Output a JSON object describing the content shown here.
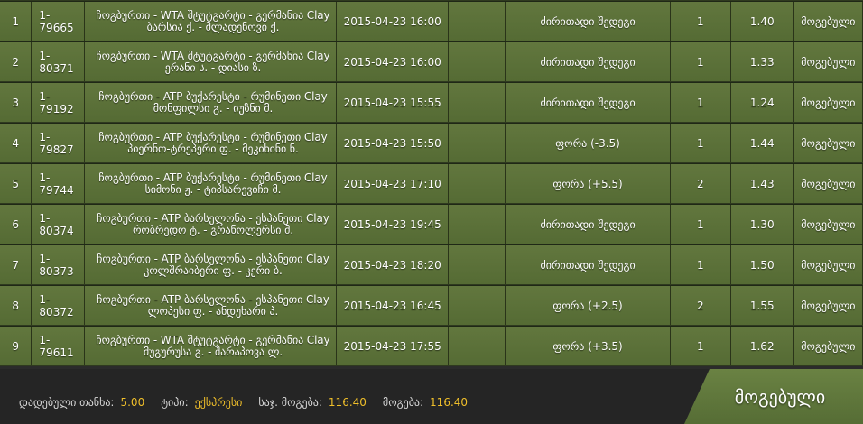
{
  "rows": [
    {
      "num": "1",
      "id": "1-79665",
      "event_line1": "ჩოგბურთი - WTA შტუტგარტი - გერმანია Clay",
      "event_line2": "ბარსია ქ. - მლადენოვი ქ.",
      "date": "2015-04-23 16:00",
      "type": "ძირითადი შედეგი",
      "count": "1",
      "odds": "1.40",
      "status": "მოგებული"
    },
    {
      "num": "2",
      "id": "1-80371",
      "event_line1": "ჩოგბურთი - WTA შტუტგარტი - გერმანია Clay",
      "event_line2": "ერანი ს. - დიასი ზ.",
      "date": "2015-04-23 16:00",
      "type": "ძირითადი შედეგი",
      "count": "1",
      "odds": "1.33",
      "status": "მოგებული"
    },
    {
      "num": "3",
      "id": "1-79192",
      "event_line1": "ჩოგბურთი - ATP ბუქარესტი - რუმინეთი Clay",
      "event_line2": "მონფილსი გ. - იუზნი მ.",
      "date": "2015-04-23 15:55",
      "type": "ძირითადი შედეგი",
      "count": "1",
      "odds": "1.24",
      "status": "მოგებული"
    },
    {
      "num": "4",
      "id": "1-79827",
      "event_line1": "ჩოგბურთი - ATP ბუქარესტი - რუმინეთი Clay",
      "event_line2": "პიერნო-ტრეპერი ფ. - მეკიხინი ნ.",
      "date": "2015-04-23 15:50",
      "type": "ფორა (-3.5)",
      "count": "1",
      "odds": "1.44",
      "status": "მოგებული"
    },
    {
      "num": "5",
      "id": "1-79744",
      "event_line1": "ჩოგბურთი - ATP ბუქარესტი - რუმინეთი Clay",
      "event_line2": "სიმონი ჟ. - ტიპსარევიჩი მ.",
      "date": "2015-04-23 17:10",
      "type": "ფორა (+5.5)",
      "count": "2",
      "odds": "1.43",
      "status": "მოგებული"
    },
    {
      "num": "6",
      "id": "1-80374",
      "event_line1": "ჩოგბურთი - ATP ბარსელონა - ესპანეთი Clay",
      "event_line2": "რობრედო ტ. - გრანოლერსი მ.",
      "date": "2015-04-23 19:45",
      "type": "ძირითადი შედეგი",
      "count": "1",
      "odds": "1.30",
      "status": "მოგებული"
    },
    {
      "num": "7",
      "id": "1-80373",
      "event_line1": "ჩოგბურთი - ATP ბარსელონა - ესპანეთი Clay",
      "event_line2": "კოლშრაიბერი ფ. - კერი ბ.",
      "date": "2015-04-23 18:20",
      "type": "ძირითადი შედეგი",
      "count": "1",
      "odds": "1.50",
      "status": "მოგებული"
    },
    {
      "num": "8",
      "id": "1-80372",
      "event_line1": "ჩოგბურთი - ATP ბარსელონა - ესპანეთი Clay",
      "event_line2": "ლოპესი ფ. - ანდუხარი პ.",
      "date": "2015-04-23 16:45",
      "type": "ფორა (+2.5)",
      "count": "2",
      "odds": "1.55",
      "status": "მოგებული"
    },
    {
      "num": "9",
      "id": "1-79611",
      "event_line1": "ჩოგბურთი - WTA შტუტგარტი - გერმანია Clay",
      "event_line2": "მუგურუსა გ. - შარაპოვა ლ.",
      "date": "2015-04-23 17:55",
      "type": "ფორა (+3.5)",
      "count": "1",
      "odds": "1.62",
      "status": "მოგებული"
    }
  ],
  "footer": {
    "stake_label": "დადებული თანხა:",
    "stake_value": "5.00",
    "type_label": "ტიპი:",
    "type_value": "ექსპრესი",
    "total_odds_label": "საჯ. მოგება:",
    "total_odds_value": "116.40",
    "win_label": "მოგება:",
    "win_value": "116.40",
    "status_button": "მოგებული"
  },
  "colors": {
    "row_green": "#5e733b",
    "accent_yellow": "#f0bf2a",
    "footer_bg": "#252525"
  }
}
